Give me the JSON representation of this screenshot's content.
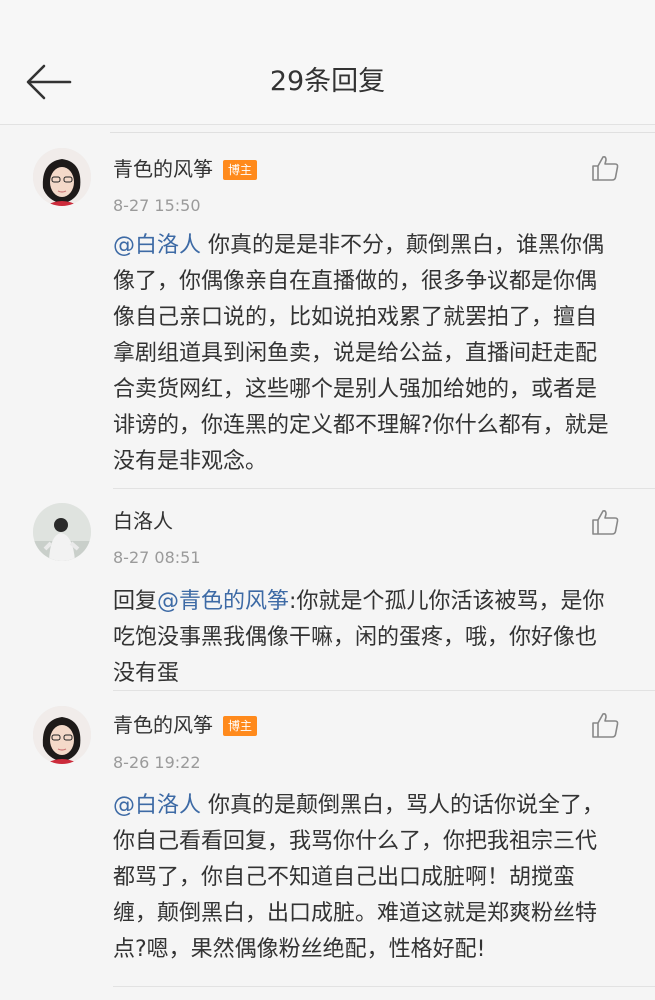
{
  "header": {
    "title": "29条回复",
    "back_icon": "arrow-left-icon"
  },
  "comments": [
    {
      "author": "青色的风筝",
      "badge": "博主",
      "time": "8-27 15:50",
      "mention": "@白洛人",
      "text": " 你真的是是非不分，颠倒黑白，谁黑你偶像了，你偶像亲自在直播做的，很多争议都是你偶像自己亲口说的，比如说拍戏累了就罢拍了，擅自拿剧组道具到闲鱼卖，说是给公益，直播间赶走配合卖货网红，这些哪个是别人强加给她的，或者是诽谤的，你连黑的定义都不理解?你什么都有，就是没有是非观念。"
    },
    {
      "author": "白洛人",
      "time": "8-27 08:51",
      "prefix": "回复",
      "mention": "@青色的风筝",
      "text": ":你就是个孤儿你活该被骂，是你吃饱没事黑我偶像干嘛，闲的蛋疼，哦，你好像也没有蛋"
    },
    {
      "author": "青色的风筝",
      "badge": "博主",
      "time": "8-26 19:22",
      "mention": "@白洛人",
      "text": " 你真的是颠倒黑白，骂人的话你说全了，你自己看看回复，我骂你什么了，你把我祖宗三代都骂了，你自己不知道自己出口成脏啊！胡搅蛮缠，颠倒黑白，出口成脏。难道这就是郑爽粉丝特点?嗯，果然偶像粉丝绝配，性格好配!"
    }
  ],
  "icons": {
    "like": "thumbs-up-icon",
    "avatar": "avatar"
  },
  "colors": {
    "badge": "#ff8a1c",
    "mention": "#3d6aa5",
    "time": "#9a9a9a"
  }
}
